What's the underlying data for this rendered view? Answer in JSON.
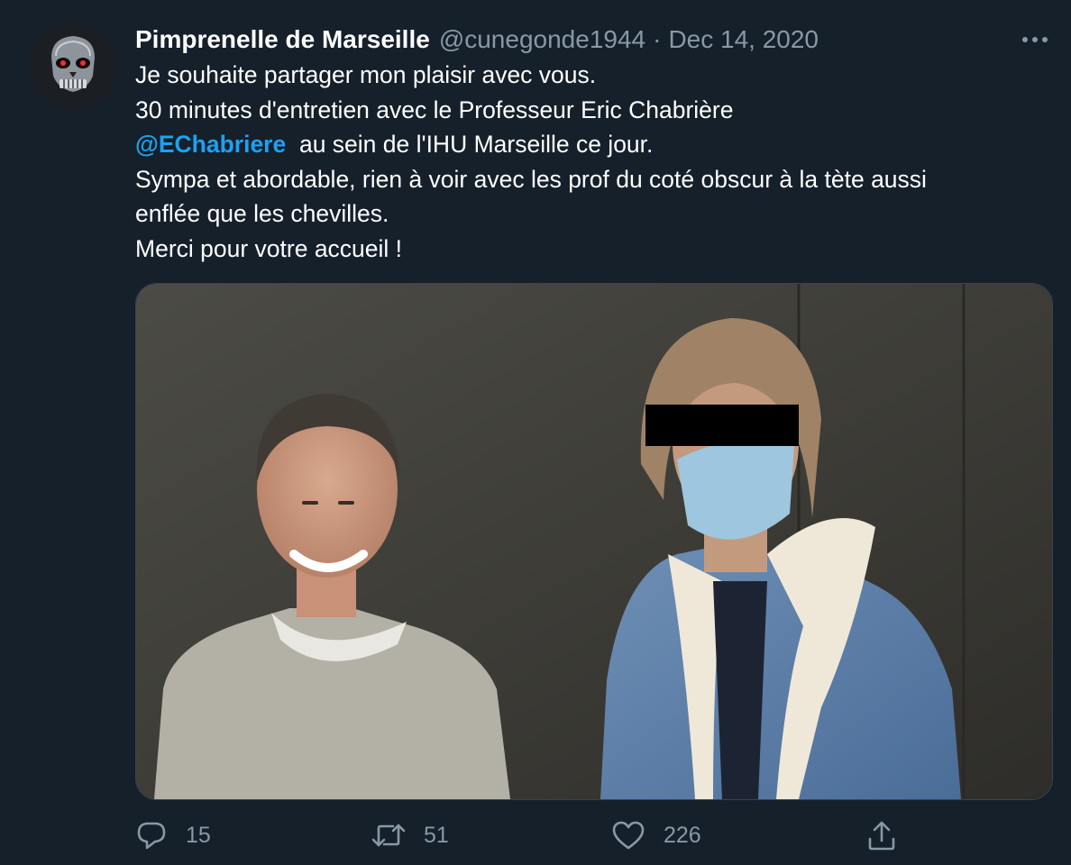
{
  "tweet": {
    "author_name": "Pimprenelle de Marseille",
    "handle": "@cunegonde1944",
    "separator": "·",
    "date": "Dec 14, 2020",
    "text": {
      "line1": "Je souhaite partager mon plaisir avec vous.",
      "line2": "30 minutes d'entretien avec le Professeur Eric Chabrière",
      "mention": "@EChabriere",
      "line3_rest": "au sein de l'IHU Marseille ce jour.",
      "line4": "Sympa et abordable, rien à voir avec les prof du coté obscur à la tète aussi",
      "line5": "enflée que les chevilles.",
      "line6": "Merci pour votre accueil !"
    },
    "actions": {
      "reply_count": "15",
      "retweet_count": "51",
      "like_count": "226"
    }
  },
  "icons": {
    "more": "more-horizontal-icon",
    "reply": "reply-icon",
    "retweet": "retweet-icon",
    "like": "heart-icon",
    "share": "share-icon"
  },
  "colors": {
    "background": "#15202b",
    "secondary_text": "#8899a6",
    "link": "#1da1f2"
  }
}
